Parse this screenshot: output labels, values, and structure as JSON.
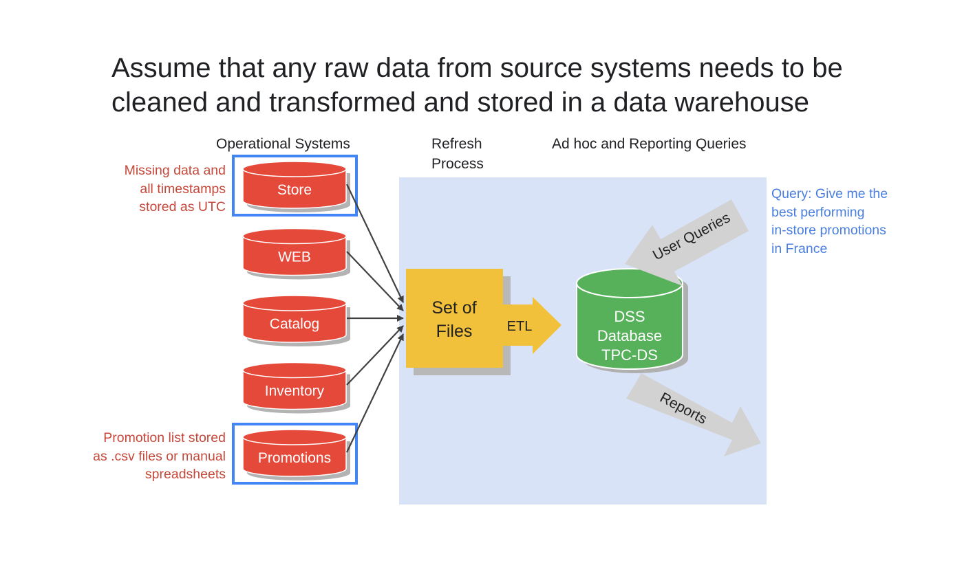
{
  "title": {
    "line1": "Assume that any raw data from source systems needs to be",
    "line2": "cleaned and transformed and stored in a data warehouse"
  },
  "headers": {
    "operational": "Operational Systems",
    "refresh_line1": "Refresh",
    "refresh_line2": "Process",
    "adhoc": "Ad hoc and Reporting Queries"
  },
  "sources": [
    {
      "label": "Store",
      "highlighted": true
    },
    {
      "label": "WEB",
      "highlighted": false
    },
    {
      "label": "Catalog",
      "highlighted": false
    },
    {
      "label": "Inventory",
      "highlighted": false
    },
    {
      "label": "Promotions",
      "highlighted": true
    }
  ],
  "notes": {
    "store_note": [
      "Missing data and",
      "all timestamps",
      "stored as UTC"
    ],
    "promo_note": [
      "Promotion list stored",
      "as .csv files or manual",
      "spreadsheets"
    ],
    "query_note": [
      "Query: Give me the",
      "best performing",
      "in-store promotions",
      "in France"
    ]
  },
  "staging": {
    "line1": "Set of",
    "line2": "Files"
  },
  "etl_label": "ETL",
  "database": {
    "line1": "DSS",
    "line2": "Database",
    "line3": "TPC-DS"
  },
  "user_queries_label": "User Queries",
  "reports_label": "Reports",
  "colors": {
    "source_red": "#e5493a",
    "highlight_blue": "#4285f4",
    "warehouse_bg": "#d9e3f8",
    "staging_yellow": "#f2c13b",
    "db_green": "#57b15b",
    "arrow_gray": "#d2d2d2",
    "note_red": "#c5483a",
    "note_blue": "#4a7fe0"
  }
}
